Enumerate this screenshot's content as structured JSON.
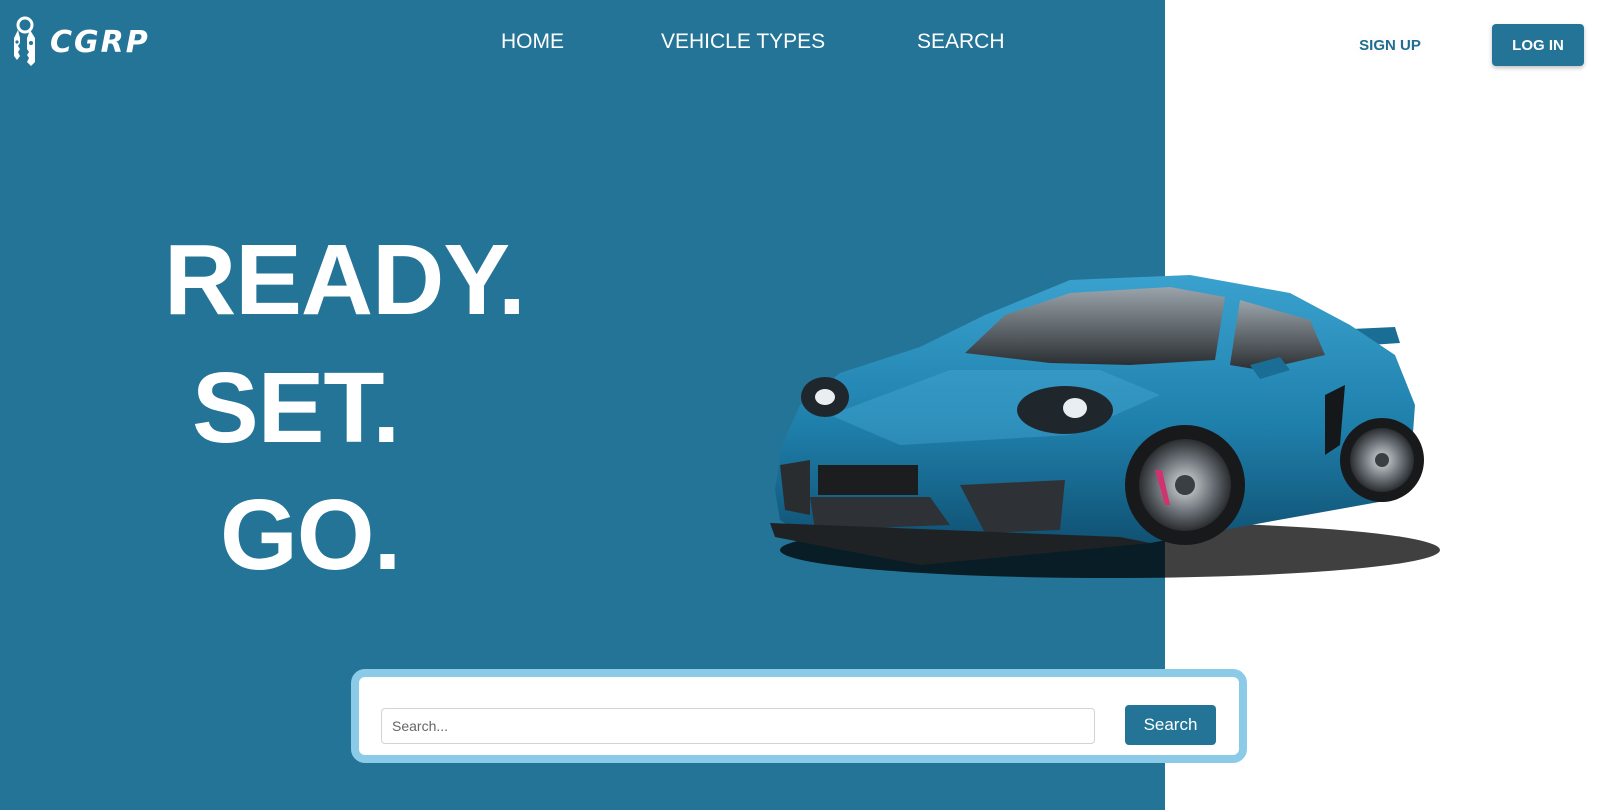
{
  "brand": {
    "name": "CGRP",
    "icon": "keys-icon"
  },
  "nav": {
    "items": [
      {
        "label": "HOME"
      },
      {
        "label": "VEHICLE TYPES"
      },
      {
        "label": "SEARCH"
      }
    ],
    "signup_label": "SIGN UP",
    "login_label": "LOG IN"
  },
  "hero": {
    "line1": "READY.",
    "line2": "SET.",
    "line3": "GO.",
    "image": "sports-car-image"
  },
  "search": {
    "placeholder": "Search...",
    "value": "",
    "button_label": "Search"
  },
  "colors": {
    "primary": "#237497",
    "search_border": "#8ccbe8",
    "background": "#ffffff"
  }
}
